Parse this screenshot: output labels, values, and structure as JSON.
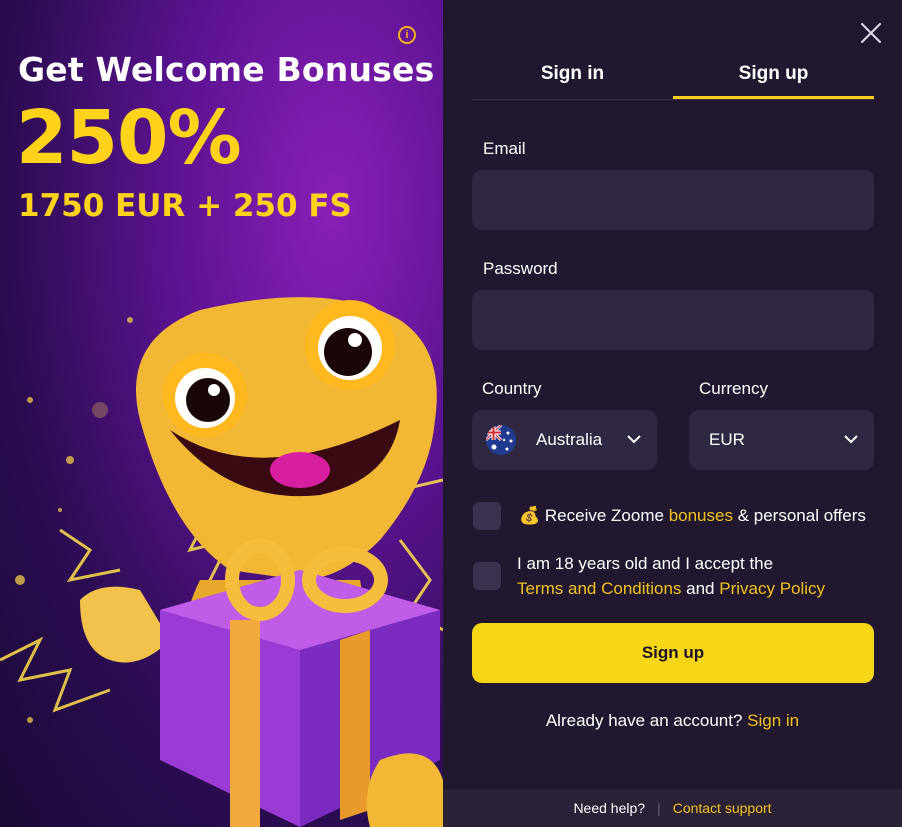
{
  "promo": {
    "title": "Get Welcome Bonuses",
    "percent": "250%",
    "amount": "1750 EUR + 250 FS",
    "info_glyph": "i"
  },
  "tabs": [
    {
      "label": "Sign in",
      "active": false
    },
    {
      "label": "Sign up",
      "active": true
    }
  ],
  "form": {
    "email_label": "Email",
    "email_value": "",
    "password_label": "Password",
    "password_value": "",
    "country_label": "Country",
    "country_value": "Australia",
    "currency_label": "Currency",
    "currency_value": "EUR",
    "bonus_check": {
      "emoji": "💰",
      "text_before": "Receive Zoome ",
      "link": "bonuses",
      "text_after": " & personal offers"
    },
    "terms_check": {
      "line1": "I am 18 years old and I accept the",
      "terms_link": "Terms and Conditions",
      "and": " and ",
      "privacy_link": "Privacy Policy"
    },
    "submit_label": "Sign up",
    "already_text": "Already have an account? ",
    "already_link": "Sign in"
  },
  "footer": {
    "help": "Need help?",
    "separator": "|",
    "support": "Contact support"
  },
  "colors": {
    "accent": "#f7d517",
    "link": "#f2c21a",
    "panel": "#21182f",
    "input": "#302842"
  }
}
